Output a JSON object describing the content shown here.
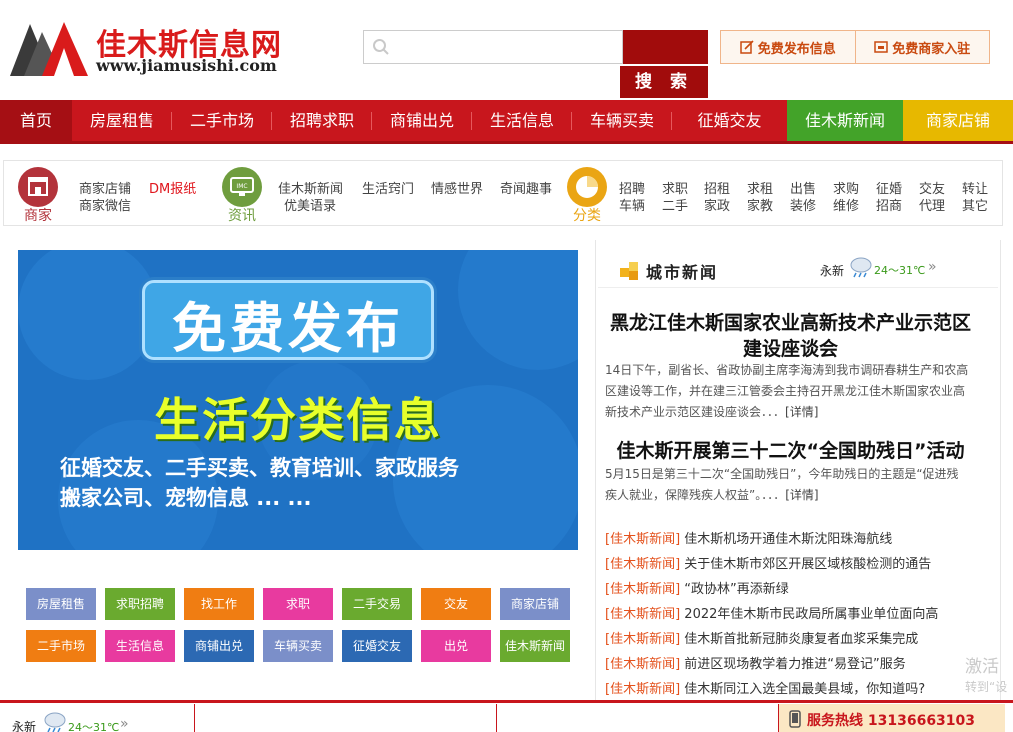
{
  "header": {
    "logo_title": "佳木斯信息网",
    "logo_url": "www.jiamusishi.com",
    "search_placeholder": "",
    "search_button": "搜 索",
    "actions": [
      {
        "label": "免费发布信息",
        "icon": "edit-icon"
      },
      {
        "label": "免费商家入驻",
        "icon": "shop-icon"
      }
    ]
  },
  "nav": {
    "items": [
      {
        "label": "首页",
        "active": true
      },
      {
        "label": "房屋租售"
      },
      {
        "label": "二手市场"
      },
      {
        "label": "招聘求职"
      },
      {
        "label": "商铺出兑"
      },
      {
        "label": "生活信息"
      },
      {
        "label": "车辆买卖"
      },
      {
        "label": "征婚交友"
      },
      {
        "label": "佳木斯新闻",
        "color": "#43a329"
      },
      {
        "label": "商家店铺",
        "color": "#e7b800"
      }
    ]
  },
  "categories": {
    "shop": {
      "name": "商家",
      "color": "#b3333b",
      "icon": "storefront-icon",
      "links": [
        "商家店铺",
        "商家微信",
        "DM报纸"
      ]
    },
    "info": {
      "name": "资讯",
      "color": "#6f9d3e",
      "icon": "monitor-icon",
      "links": [
        "佳木斯新闻",
        "优美语录",
        "生活窍门",
        "情感世界",
        "奇闻趣事"
      ]
    },
    "classify": {
      "name": "分类",
      "color": "#eaa514",
      "icon": "pie-icon",
      "links": [
        "招聘",
        "车辆",
        "求职",
        "二手",
        "招租",
        "家政",
        "求租",
        "家教",
        "出售",
        "装修",
        "求购",
        "维修",
        "征婚",
        "招商",
        "交友",
        "代理",
        "转让",
        "其它"
      ]
    }
  },
  "banner": {
    "title": "免费发布",
    "subtitle": "生活分类信息",
    "line1": "征婚交友、二手买卖、教育培训、家政服务",
    "line2": "搬家公司、宠物信息 ... ..."
  },
  "tags": [
    {
      "label": "房屋租售",
      "color": "#7b8fc9"
    },
    {
      "label": "求职招聘",
      "color": "#6aaa2f"
    },
    {
      "label": "找工作",
      "color": "#f07d12"
    },
    {
      "label": "求职",
      "color": "#e83a9f"
    },
    {
      "label": "二手交易",
      "color": "#6aaa2f"
    },
    {
      "label": "交友",
      "color": "#f07d12"
    },
    {
      "label": "商家店铺",
      "color": "#7b8fc9"
    },
    {
      "label": "二手市场",
      "color": "#f07d12"
    },
    {
      "label": "生活信息",
      "color": "#e83a9f"
    },
    {
      "label": "商铺出兑",
      "color": "#2c69b3"
    },
    {
      "label": "车辆买卖",
      "color": "#7b8fc9"
    },
    {
      "label": "征婚交友",
      "color": "#2c69b3"
    },
    {
      "label": "出兑",
      "color": "#e83a9f"
    },
    {
      "label": "佳木斯新闻",
      "color": "#6aaa2f"
    }
  ],
  "city_news": {
    "title": "城市新闻",
    "weather": {
      "city": "永新",
      "temp": "24～31℃",
      "more": "»",
      "icon": "rain-cloud-icon"
    },
    "headline1": {
      "title_line1": "黑龙江佳木斯国家农业高新技术产业示范区",
      "title_line2": "建设座谈会",
      "summary_line1": "14日下午，副省长、省政协副主席李海涛到我市调研春耕生产和农高",
      "summary_line2": "区建设等工作，并在建三江管委会主持召开黑龙江佳木斯国家农业高",
      "summary_line3": "新技术产业示范区建设座谈会．．．",
      "more": "[详情]"
    },
    "headline2": {
      "title": "佳木斯开展第三十二次“全国助残日”活动",
      "summary_line1": "5月15日是第三十二次“全国助残日”，今年助残日的主题是“促进残",
      "summary_line2": "疾人就业，保障残疾人权益”。．．．",
      "more": "[详情]"
    },
    "items": [
      {
        "tag": "[佳木斯新闻]",
        "text": "佳木斯机场开通佳木斯沈阳珠海航线"
      },
      {
        "tag": "[佳木斯新闻]",
        "text": "关于佳木斯市郊区开展区域核酸检测的通告"
      },
      {
        "tag": "[佳木斯新闻]",
        "text": "“政协林”再添新绿"
      },
      {
        "tag": "[佳木斯新闻]",
        "text": " 2022年佳木斯市民政局所属事业单位面向高"
      },
      {
        "tag": "[佳木斯新闻]",
        "text": "佳木斯首批新冠肺炎康复者血浆采集完成"
      },
      {
        "tag": "[佳木斯新闻]",
        "text": "前进区现场教学着力推进“易登记”服务"
      },
      {
        "tag": "[佳木斯新闻]",
        "text": "佳木斯同江入选全国最美县域，你知道吗?"
      }
    ]
  },
  "side_overlay": {
    "line1": "激活",
    "line2": "转到“设"
  },
  "footer": {
    "weather": {
      "city": "永新",
      "temp": "24～31℃",
      "more": "»",
      "icon": "rain-cloud-icon"
    },
    "hotline": "服务热线 13136663103",
    "hotline_icon": "phone-icon"
  }
}
